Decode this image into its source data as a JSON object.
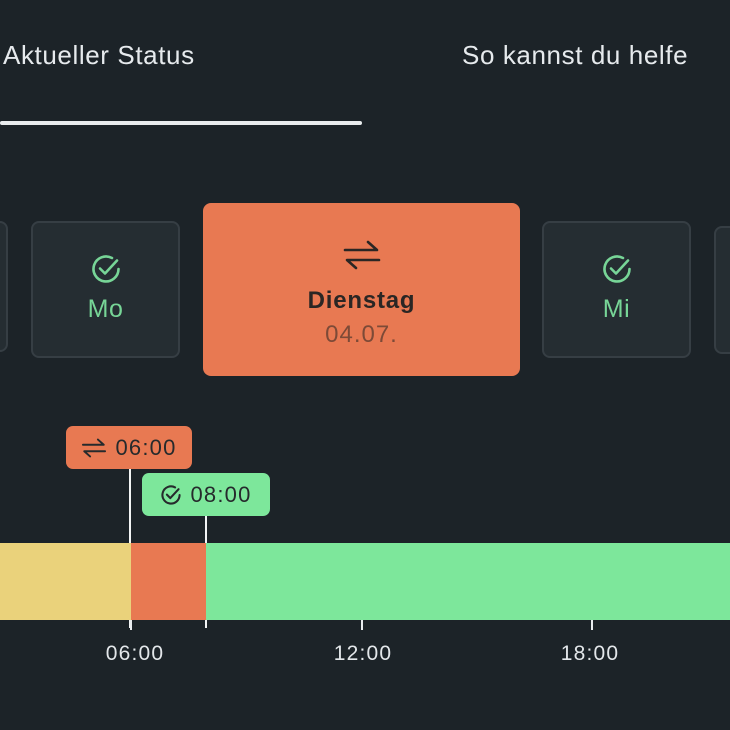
{
  "tabs": [
    {
      "label": "Aktueller Status",
      "active": true
    },
    {
      "label": "So kannst du helfe",
      "active": false
    }
  ],
  "days": {
    "mo": {
      "label": "Mo",
      "icon": "check-circle-icon",
      "status_color": "#77d597"
    },
    "selected": {
      "title": "Dienstag",
      "date": "04.07.",
      "icon": "swap-arrows-icon",
      "color": "#e87952"
    },
    "mi": {
      "label": "Mi",
      "icon": "check-circle-icon",
      "status_color": "#77d597"
    }
  },
  "timeline": {
    "events": [
      {
        "time": "06:00",
        "icon": "swap-arrows-icon",
        "color": "#e87952"
      },
      {
        "time": "08:00",
        "icon": "check-circle-icon",
        "color": "#7de79b"
      }
    ],
    "segments": [
      {
        "color": "#ead27b"
      },
      {
        "color": "#e87952"
      },
      {
        "color": "#7de79b"
      }
    ],
    "ticks": [
      "06:00",
      "12:00",
      "18:00"
    ]
  }
}
